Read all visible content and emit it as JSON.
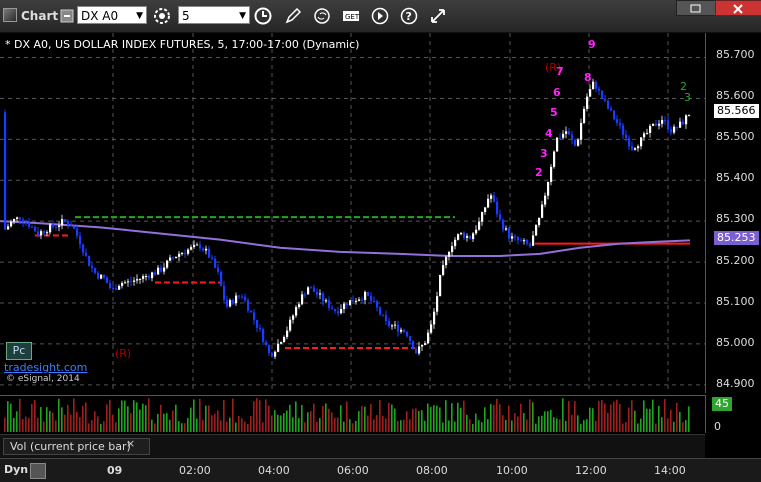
{
  "toolbar": {
    "title": "Chart",
    "symbol": "DX A0",
    "interval": "5",
    "icons": [
      "link-icon",
      "settings-gear-icon",
      "clock-icon",
      "pencil-icon",
      "refresh-icon",
      "get-quote-icon",
      "play-icon",
      "help-icon",
      "move-arrows-icon",
      "restore-icon",
      "close-icon"
    ]
  },
  "chart": {
    "title": "* DX A0, US DOLLAR INDEX FUTURES, 5, 17:00-17:00 (Dynamic)",
    "pc_label": "Pc",
    "site": "tradesight.com",
    "copyright": "© eSignal, 2014"
  },
  "price_axis": {
    "labels": [
      "85.700",
      "85.600",
      "85.500",
      "85.400",
      "85.300",
      "85.200",
      "85.100",
      "85.000",
      "84.900"
    ],
    "last_price": "85.566",
    "ma_value": "85.253"
  },
  "volume": {
    "tab_label": "Vol (current price bar)",
    "close_symbol": "×",
    "axis_value": "45",
    "axis_zero": "0"
  },
  "time_axis": {
    "mode": "Dyn",
    "labels": [
      "09",
      "02:00",
      "04:00",
      "06:00",
      "08:00",
      "10:00",
      "12:00",
      "14:00"
    ]
  },
  "annotations": {
    "r_marks": [
      "(R)",
      "(R)"
    ],
    "magenta_counts": [
      "2",
      "3",
      "4",
      "5",
      "6",
      "7",
      "8",
      "9"
    ],
    "green_counts": [
      "2",
      "3"
    ]
  },
  "colors": {
    "up_candle": "#ffffff",
    "down_candle": "#1a3cff",
    "ma_line": "#9370db",
    "support_red": "#ff1a1a",
    "resistance_green": "#22aa22",
    "count_magenta": "#ff22ff",
    "count_green": "#22aa22",
    "vol_up": "#1ea51e",
    "vol_down": "#a01e1e"
  },
  "chart_data": {
    "type": "candlestick",
    "ylim": [
      84.88,
      85.76
    ],
    "ma_series": [
      [
        0,
        85.3
      ],
      [
        40,
        85.295
      ],
      [
        100,
        85.285
      ],
      [
        160,
        85.27
      ],
      [
        220,
        85.255
      ],
      [
        280,
        85.235
      ],
      [
        340,
        85.225
      ],
      [
        400,
        85.22
      ],
      [
        450,
        85.215
      ],
      [
        500,
        85.215
      ],
      [
        540,
        85.22
      ],
      [
        580,
        85.235
      ],
      [
        620,
        85.245
      ],
      [
        660,
        85.25
      ],
      [
        690,
        85.253
      ]
    ],
    "close_series": [
      [
        5,
        85.28
      ],
      [
        12,
        85.3
      ],
      [
        20,
        85.31
      ],
      [
        30,
        85.29
      ],
      [
        38,
        85.27
      ],
      [
        46,
        85.28
      ],
      [
        56,
        85.29
      ],
      [
        64,
        85.3
      ],
      [
        72,
        85.29
      ],
      [
        80,
        85.25
      ],
      [
        88,
        85.2
      ],
      [
        96,
        85.17
      ],
      [
        104,
        85.16
      ],
      [
        112,
        85.13
      ],
      [
        120,
        85.15
      ],
      [
        128,
        85.15
      ],
      [
        140,
        85.16
      ],
      [
        150,
        85.17
      ],
      [
        160,
        85.18
      ],
      [
        168,
        85.2
      ],
      [
        178,
        85.22
      ],
      [
        188,
        85.23
      ],
      [
        200,
        85.24
      ],
      [
        208,
        85.22
      ],
      [
        218,
        85.17
      ],
      [
        226,
        85.09
      ],
      [
        234,
        85.11
      ],
      [
        242,
        85.12
      ],
      [
        252,
        85.07
      ],
      [
        262,
        85.02
      ],
      [
        270,
        84.97
      ],
      [
        278,
        85.0
      ],
      [
        288,
        85.04
      ],
      [
        298,
        85.1
      ],
      [
        308,
        85.14
      ],
      [
        318,
        85.12
      ],
      [
        326,
        85.1
      ],
      [
        336,
        85.08
      ],
      [
        346,
        85.1
      ],
      [
        356,
        85.11
      ],
      [
        366,
        85.12
      ],
      [
        376,
        85.09
      ],
      [
        386,
        85.05
      ],
      [
        396,
        85.04
      ],
      [
        406,
        85.03
      ],
      [
        416,
        84.98
      ],
      [
        424,
        85.0
      ],
      [
        432,
        85.05
      ],
      [
        440,
        85.16
      ],
      [
        450,
        85.24
      ],
      [
        460,
        85.27
      ],
      [
        470,
        85.26
      ],
      [
        480,
        85.3
      ],
      [
        490,
        85.37
      ],
      [
        500,
        85.3
      ],
      [
        510,
        85.26
      ],
      [
        520,
        85.25
      ],
      [
        530,
        85.24
      ],
      [
        540,
        85.31
      ],
      [
        548,
        85.4
      ],
      [
        556,
        85.5
      ],
      [
        566,
        85.52
      ],
      [
        576,
        85.48
      ],
      [
        586,
        85.6
      ],
      [
        594,
        85.64
      ],
      [
        602,
        85.6
      ],
      [
        612,
        85.56
      ],
      [
        622,
        85.52
      ],
      [
        632,
        85.48
      ],
      [
        642,
        85.5
      ],
      [
        652,
        85.53
      ],
      [
        662,
        85.55
      ],
      [
        672,
        85.52
      ],
      [
        682,
        85.54
      ],
      [
        690,
        85.566
      ]
    ],
    "levels": [
      {
        "kind": "resistance",
        "y": 85.31,
        "x_from": 75,
        "x_to": 455
      },
      {
        "kind": "support",
        "y": 85.265,
        "x_from": 35,
        "x_to": 70
      },
      {
        "kind": "support",
        "y": 85.15,
        "x_from": 155,
        "x_to": 220
      },
      {
        "kind": "support",
        "y": 84.99,
        "x_from": 285,
        "x_to": 415
      },
      {
        "kind": "support",
        "y": 85.245,
        "x_from": 535,
        "x_to": 690
      }
    ]
  }
}
